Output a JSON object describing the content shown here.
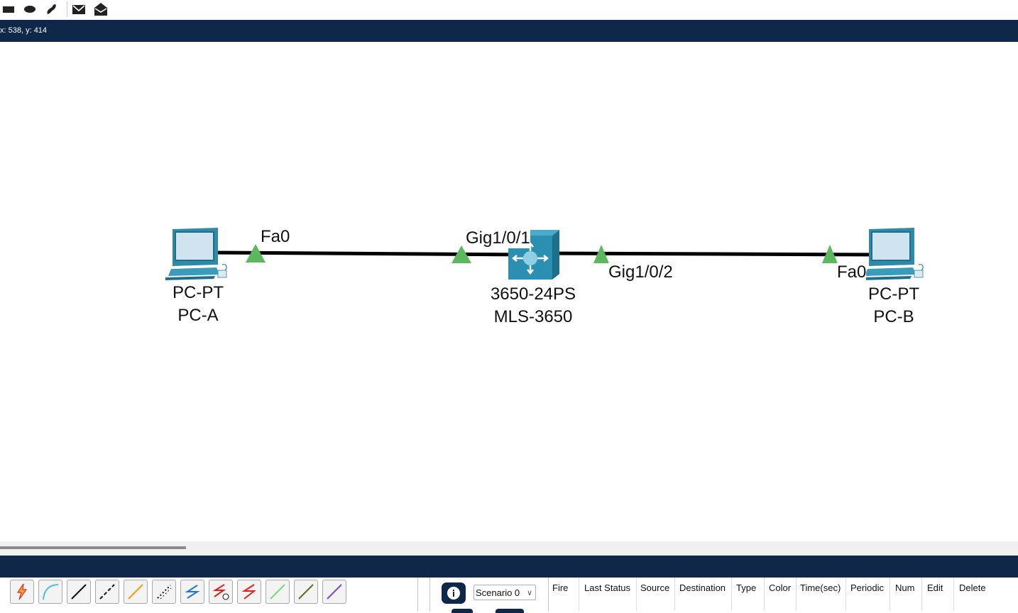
{
  "toolbar": {
    "icons": [
      "rectangle-icon",
      "ellipse-icon",
      "freeform-icon",
      "simple-pdu-icon",
      "complex-pdu-icon"
    ]
  },
  "status": {
    "coords": "x: 538, y: 414"
  },
  "workspace": {
    "devices": [
      {
        "id": "pc-a",
        "model": "PC-PT",
        "name": "PC-A",
        "icon": "pc-icon"
      },
      {
        "id": "mls",
        "model": "3650-24PS",
        "name": "MLS-3650",
        "icon": "multilayer-switch-icon"
      },
      {
        "id": "pc-b",
        "model": "PC-PT",
        "name": "PC-B",
        "icon": "pc-icon"
      }
    ],
    "links": [
      {
        "from": "PC-A",
        "from_port": "Fa0",
        "to": "MLS-3650",
        "to_port": "Gig1/0/1"
      },
      {
        "from": "MLS-3650",
        "from_port": "Gig1/0/2",
        "to": "PC-B",
        "to_port": "Fa0"
      }
    ],
    "link_status_color": "#5cb85c"
  },
  "connections": {
    "tools": [
      "automatic-connection-icon",
      "console-cable-icon",
      "copper-straight-through-icon",
      "copper-cross-over-icon",
      "fiber-icon",
      "phone-cable-icon",
      "coaxial-icon",
      "serial-dce-icon",
      "serial-dte-icon",
      "octal-cable-icon",
      "iot-custom-cable-icon",
      "usb-cable-icon"
    ]
  },
  "pdu": {
    "scenario": "Scenario 0",
    "columns": [
      "Fire",
      "Last Status",
      "Source",
      "Destination",
      "Type",
      "Color",
      "Time(sec)",
      "Periodic",
      "Num",
      "Edit",
      "Delete"
    ]
  },
  "colors": {
    "bar": "#0f284a",
    "link": "#000000"
  }
}
